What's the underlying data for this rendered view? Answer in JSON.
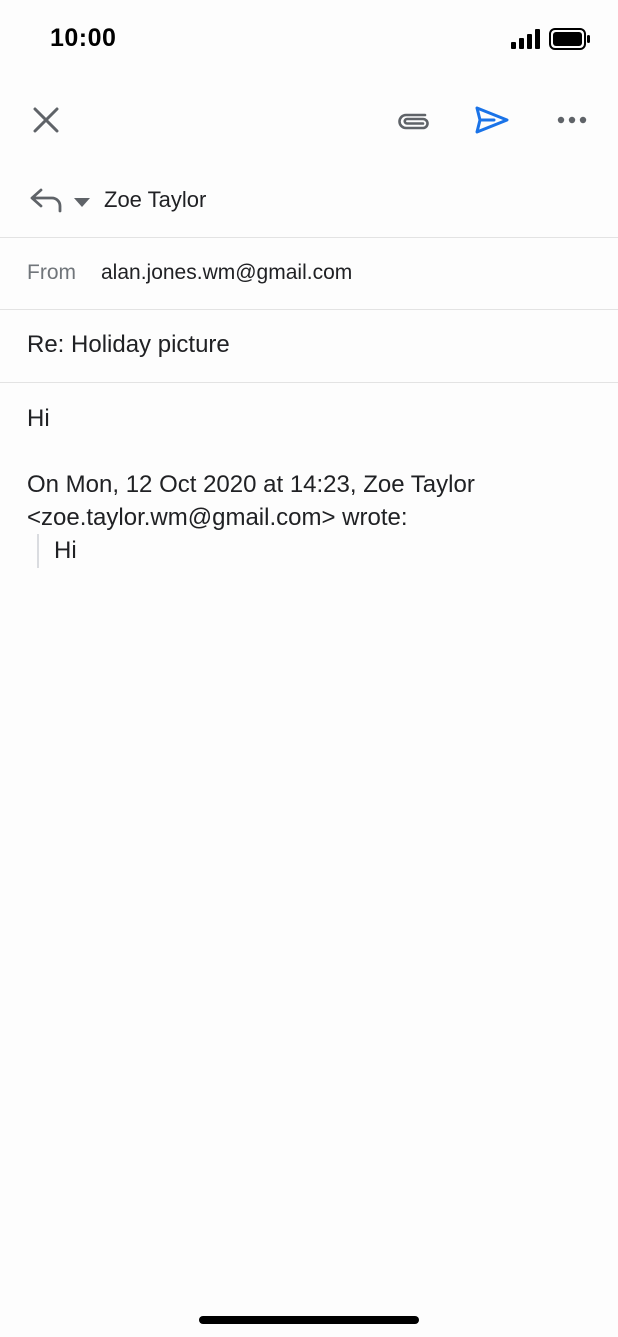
{
  "status_bar": {
    "time": "10:00",
    "signal_icon": "cellular-signal-icon",
    "battery_icon": "battery-full-icon"
  },
  "toolbar": {
    "close_icon": "close-icon",
    "attach_icon": "attachment-icon",
    "send_icon": "send-icon",
    "more_icon": "more-horizontal-icon",
    "accent_color": "#1a73e8"
  },
  "recipient": {
    "reply_icon": "reply-icon",
    "dropdown_icon": "caret-down-icon",
    "name": "Zoe Taylor"
  },
  "from": {
    "label": "From",
    "address": "alan.jones.wm@gmail.com"
  },
  "subject": {
    "value": "Re: Holiday picture"
  },
  "body": {
    "greeting": "Hi",
    "quote_header": "On Mon, 12 Oct 2020 at 14:23, Zoe Taylor <zoe.taylor.wm@gmail.com> wrote:",
    "quoted_text": "Hi"
  }
}
